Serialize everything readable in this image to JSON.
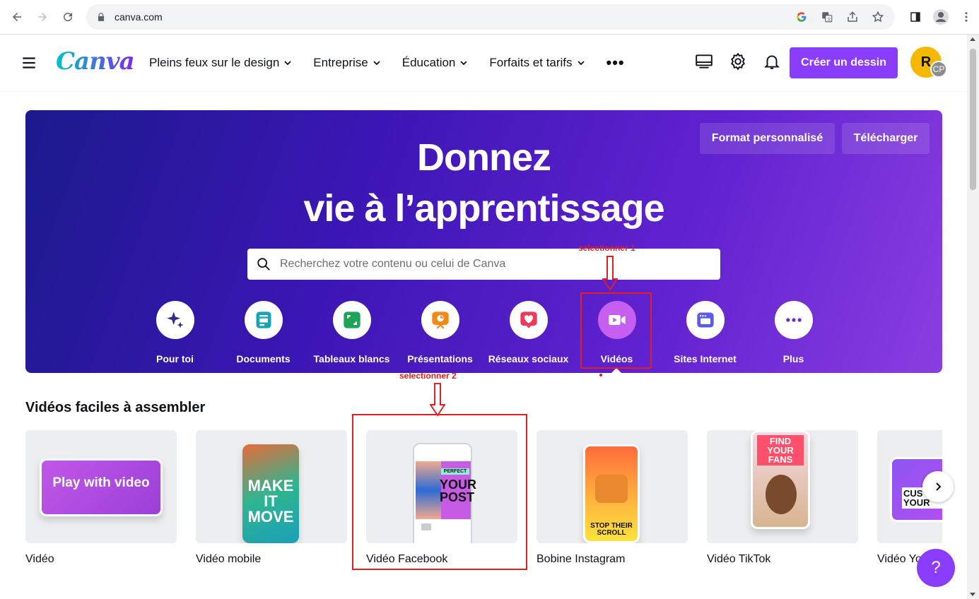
{
  "browser": {
    "url": "canva.com"
  },
  "header": {
    "logo": "Canva",
    "menu": [
      {
        "label": "Pleins feux sur le design"
      },
      {
        "label": "Entreprise"
      },
      {
        "label": "Éducation"
      },
      {
        "label": "Forfaits et tarifs"
      }
    ],
    "more": "•••",
    "create_button": "Créer un dessin",
    "avatar_initial": "R",
    "avatar_sub": "CP"
  },
  "hero": {
    "title_line1": "Donnez",
    "title_line2": "vie à l’apprentissage",
    "custom_size_button": "Format personnalisé",
    "upload_button": "Télécharger",
    "search_placeholder": "Recherchez votre contenu ou celui de Canva",
    "categories": [
      {
        "label": "Pour toi",
        "icon": "sparkle-icon",
        "color": "#2f2c8f"
      },
      {
        "label": "Documents",
        "icon": "document-icon",
        "color": "#14a3b8"
      },
      {
        "label": "Tableaux blancs",
        "icon": "whiteboard-icon",
        "color": "#1ea35a"
      },
      {
        "label": "Présentations",
        "icon": "presentation-icon",
        "color": "#f28a1a"
      },
      {
        "label": "Réseaux sociaux",
        "icon": "heart-icon",
        "color": "#ee3b5a"
      },
      {
        "label": "Vidéos",
        "icon": "video-camera-icon",
        "color": "#b44bf0"
      },
      {
        "label": "Sites Internet",
        "icon": "website-icon",
        "color": "#5b5be8"
      },
      {
        "label": "Plus",
        "icon": "more-icon",
        "color": "#6c2ad6"
      }
    ]
  },
  "annotations": {
    "step1": "selectionner 1",
    "step2": "selectionner 2"
  },
  "section": {
    "title": "Vidéos faciles à assembler",
    "cards": [
      {
        "label": "Vidéo",
        "art": "Play with video"
      },
      {
        "label": "Vidéo mobile",
        "art": "MAKE IT MOVE"
      },
      {
        "label": "Vidéo Facebook",
        "art": "YOUR POST",
        "art_badge": "PERFECT"
      },
      {
        "label": "Bobine Instagram",
        "art": "STOP THEIR SCROLL"
      },
      {
        "label": "Vidéo TikTok",
        "art": "FIND YOUR FANS"
      },
      {
        "label": "Vidéo YouTube",
        "art": "CUS YOUR"
      }
    ]
  },
  "help": "?",
  "colors": {
    "brand": "#8b3dff",
    "annotation": "#e02020"
  }
}
